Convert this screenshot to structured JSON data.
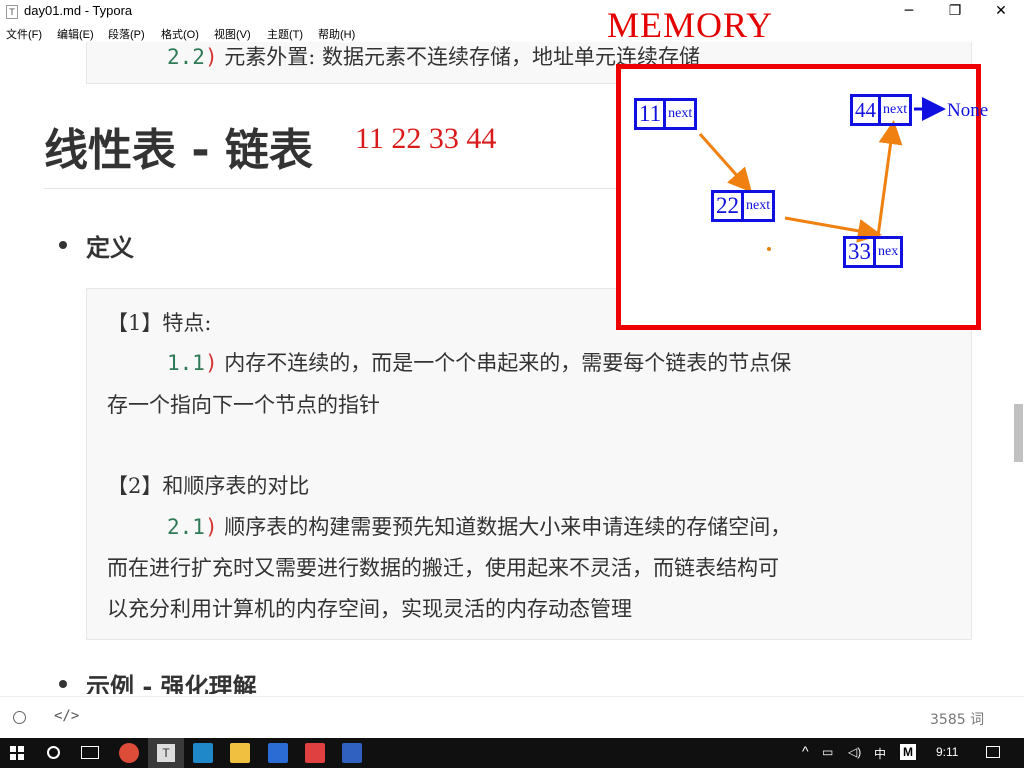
{
  "window": {
    "title": "day01.md - Typora",
    "app_icon": "T",
    "minimize": "─",
    "maximize": "❐",
    "close": "✕"
  },
  "menu": [
    "文件(F)",
    "编辑(E)",
    "段落(P)",
    "格式(O)",
    "视图(V)",
    "主题(T)",
    "帮助(H)"
  ],
  "doc": {
    "top_box_line": {
      "num": "2.2",
      "paren": ")",
      "text": "元素外置: 数据元素不连续存储，地址单元连续存储"
    },
    "heading": "线性表 - 链表",
    "heading_numbers": "11  22  33  44",
    "section_def": "定义",
    "def_box": {
      "p1_title": "【1】特点:",
      "p1_num": "1.1",
      "p1_paren": ")",
      "p1_text_a": "内存不连续的，而是一个个串起来的，需要每个链表的节点保",
      "p1_text_b": "存一个指向下一个节点的指针",
      "p2_title": "【2】和顺序表的对比",
      "p2_num": "2.1",
      "p2_paren": ")",
      "p2_text_a": "顺序表的构建需要预先知道数据大小来申请连续的存储空间，",
      "p2_text_b": "而在进行扩充时又需要进行数据的搬迁，使用起来不灵活，而链表结构可",
      "p2_text_c": "以充分利用计算机的内存空间，实现灵活的内存动态管理"
    },
    "section_example": "示例 - 强化理解"
  },
  "memory": {
    "title": "MEMORY",
    "nodes": [
      {
        "value": "11",
        "next": "next"
      },
      {
        "value": "22",
        "next": "next"
      },
      {
        "value": "33",
        "next": "nex"
      },
      {
        "value": "44",
        "next": "next"
      }
    ],
    "end_label": "None",
    "colors": {
      "frame": "#ee0000",
      "node": "#1010e0",
      "arrow": "#f08010"
    }
  },
  "statusbar": {
    "toggle_icon": "circle-icon",
    "source_icon": "code-icon",
    "word_count": "3585 词"
  },
  "taskbar": {
    "tray_lang": "中",
    "tray_ime": "M",
    "time": "9:11"
  }
}
